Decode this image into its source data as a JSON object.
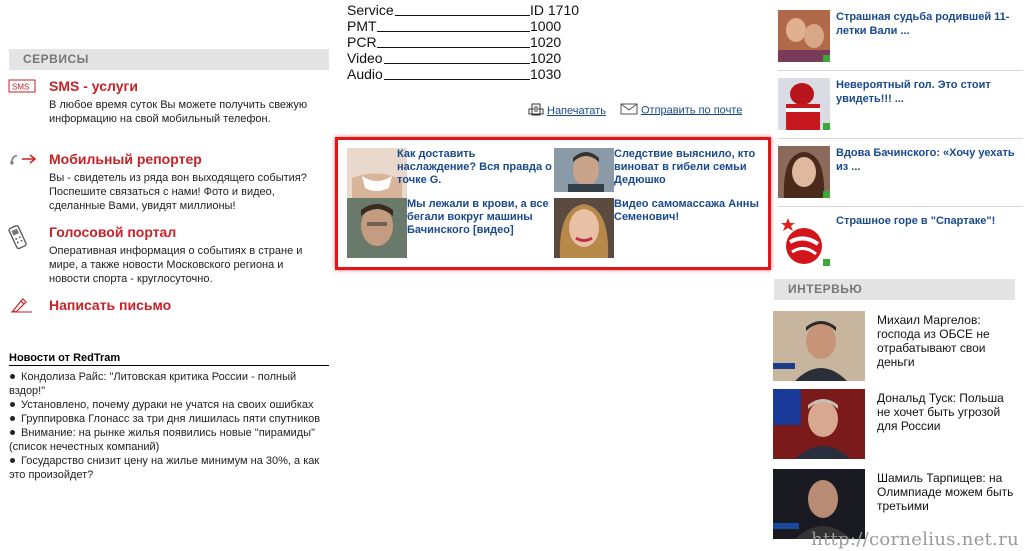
{
  "services": {
    "header": "СЕРВИСЫ",
    "items": [
      {
        "title": "SMS - услуги",
        "desc": "В любое время суток Вы можете получить свежую информацию на свой мобильный телефон.",
        "icon": "sms-icon"
      },
      {
        "title": "Мобильный репортер",
        "desc": "Вы - свидетель из ряда вон выходящего события? Поспешите связаться с нами! Фото и видео, сделанные Вами, увидят миллионы!",
        "icon": "reporter-icon"
      },
      {
        "title": "Голосовой портал",
        "desc": "Оперативная информация о событиях в стране и мире, а также новости Московского региона и новости спорта - круглосуточно.",
        "icon": "phone-icon"
      },
      {
        "title": "Написать письмо",
        "desc": "",
        "icon": "pen-icon"
      }
    ],
    "sms_label": "SMS"
  },
  "redtram": {
    "title": "Новости от RedTram",
    "items": [
      "Кондолиза Райс: \"Литовская критика России - полный вздор!\"",
      "Установлено, почему дураки не учатся на своих ошибках",
      "Группировка Глонасс за три дня лишилась пяти спутников",
      "Внимание: на рынке жилья появились новые \"пирамиды\" (список нечестных компаний)",
      "Государство снизит цену на жилье минимум на 30%, а как это произойдет?"
    ]
  },
  "tech": {
    "rows": [
      {
        "label": "Service",
        "value": "ID 1710"
      },
      {
        "label": "PMT",
        "value": "1000"
      },
      {
        "label": "PCR",
        "value": "1020"
      },
      {
        "label": "Video",
        "value": "1020"
      },
      {
        "label": "Audio",
        "value": "1030"
      }
    ]
  },
  "actions": {
    "print": "Напечатать",
    "mail": "Отправить по почте"
  },
  "promo": [
    {
      "text": "Как доставить наслаждение? Вся правда о точке G."
    },
    {
      "text": "Следствие выяснило, кто виноват в гибели семьи Дедюшко"
    },
    {
      "text": "Мы лежали в крови, а все бегали вокруг машины Бачинского [видео]"
    },
    {
      "text": "Видео самомассажа Анны Семенович!"
    }
  ],
  "right_news": [
    {
      "text": "Страшная судьба родившей 11-летки Вали ..."
    },
    {
      "text": "Невероятный гол. Это стоит увидеть!!! ..."
    },
    {
      "text": "Вдова Бачинского: «Хочу уехать из ..."
    },
    {
      "text": "Страшное горе в \"Спартаке\"!"
    }
  ],
  "interview": {
    "header": "ИНТЕРВЬЮ",
    "items": [
      {
        "text": "Михаил Маргелов: господа из ОБСЕ не отрабатывают свои деньги"
      },
      {
        "text": "Дональд Туск: Польша не хочет быть угрозой для России"
      },
      {
        "text": "Шамиль Тарпищев: на Олимпиаде можем быть третьими"
      }
    ]
  },
  "watermark": "http://cornelius.net.ru",
  "colors": {
    "accent_red": "#c82127",
    "link_blue": "#1a4a8c",
    "frame_red": "#e4141b",
    "header_gray": "#e4e4e4"
  }
}
